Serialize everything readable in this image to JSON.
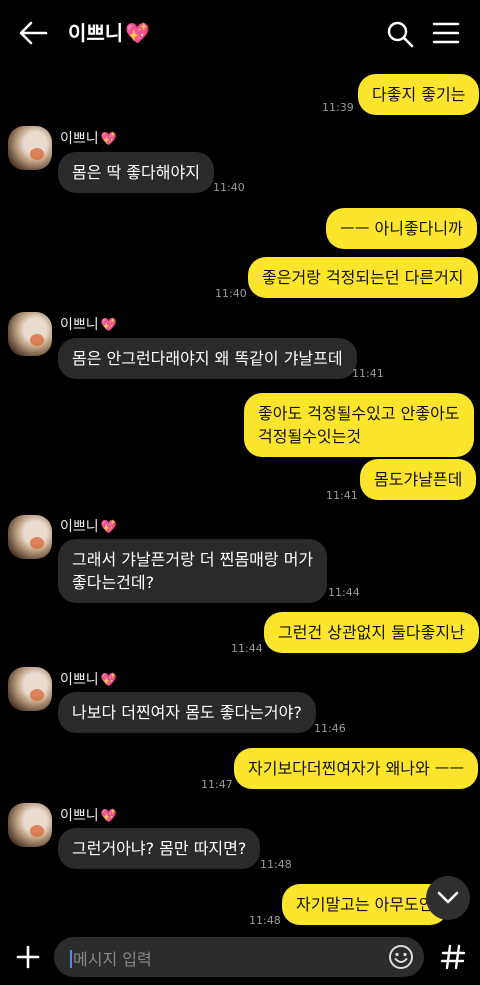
{
  "header": {
    "title": "이쁘니",
    "title_emoji": "💖"
  },
  "messages": [
    {
      "side": "out",
      "text": "다좋지 좋기는",
      "time": "11:39"
    },
    {
      "side": "in",
      "sender": "이쁘니",
      "sender_emoji": "💖",
      "text": "몸은 딱 좋다해야지",
      "time": "11:40"
    },
    {
      "side": "out",
      "text": "ㅡㅡ 아니좋다니까"
    },
    {
      "side": "out",
      "text": "좋은거랑 걱정되는던 다른거지",
      "time": "11:40"
    },
    {
      "side": "in",
      "sender": "이쁘니",
      "sender_emoji": "💖",
      "text": "몸은 안그런다래야지 왜 똑같이 갸날프데",
      "time": "11:41"
    },
    {
      "side": "out",
      "text_line1": "좋아도 걱정될수있고 안좋아도",
      "text_line2": "걱정될수잇는것"
    },
    {
      "side": "out",
      "text": "몸도갸냘픈데",
      "time": "11:41"
    },
    {
      "side": "in",
      "sender": "이쁘니",
      "sender_emoji": "💖",
      "text_line1": "그래서 갸날픈거랑 더 찐몸매랑 머가",
      "text_line2": "좋다는건데?",
      "time": "11:44"
    },
    {
      "side": "out",
      "text": "그런건 상관없지 둘다좋지난",
      "time": "11:44"
    },
    {
      "side": "in",
      "sender": "이쁘니",
      "sender_emoji": "💖",
      "text": "나보다 더찐여자 몸도 좋다는거야?",
      "time": "11:46"
    },
    {
      "side": "out",
      "text": "자기보다더찐여자가 왜나와 ㅡㅡ",
      "time": "11:47"
    },
    {
      "side": "in",
      "sender": "이쁘니",
      "sender_emoji": "💖",
      "text": "그런거아냐? 몸만 따지면?",
      "time": "11:48"
    },
    {
      "side": "out",
      "text": "자기말고는 아무도안",
      "time": "11:48"
    }
  ],
  "input": {
    "placeholder": "메시지 입력"
  },
  "colors": {
    "outgoing_bubble": "#fde52e",
    "incoming_bubble": "#2a2a2a",
    "background": "#000000"
  },
  "icons": [
    "back-arrow-icon",
    "search-icon",
    "menu-icon",
    "plus-icon",
    "emoji-icon",
    "hash-icon",
    "chevron-down-icon"
  ]
}
